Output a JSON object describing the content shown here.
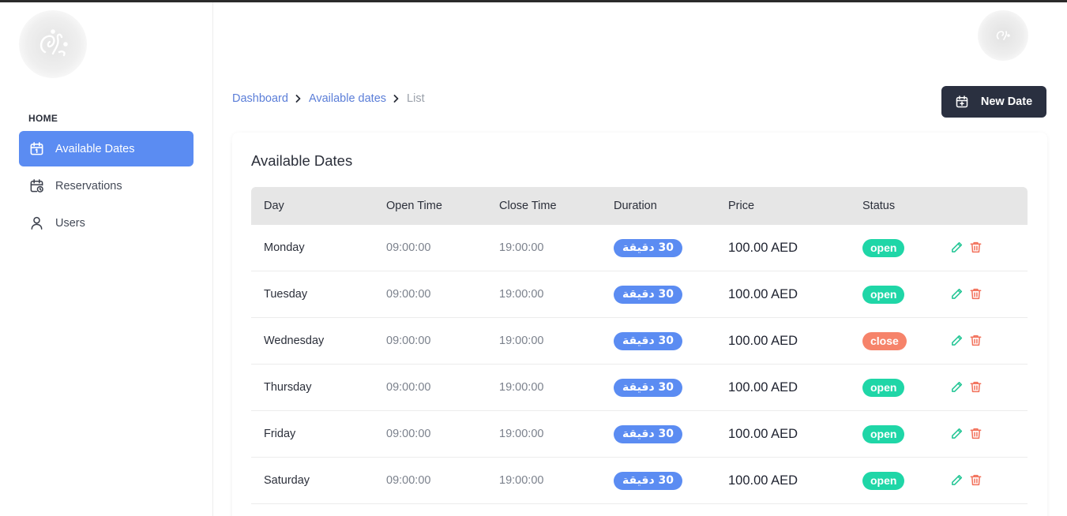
{
  "sidebar": {
    "section_label": "HOME",
    "items": [
      {
        "label": "Available Dates",
        "icon": "calendar-icon",
        "active": true
      },
      {
        "label": "Reservations",
        "icon": "calendar-clock-icon",
        "active": false
      },
      {
        "label": "Users",
        "icon": "user-icon",
        "active": false
      }
    ]
  },
  "breadcrumb": {
    "items": [
      "Dashboard",
      "Available dates",
      "List"
    ]
  },
  "toolbar": {
    "new_date_label": "New Date"
  },
  "card": {
    "title": "Available Dates"
  },
  "table": {
    "columns": [
      "Day",
      "Open Time",
      "Close Time",
      "Duration",
      "Price",
      "Status"
    ],
    "rows": [
      {
        "day": "Monday",
        "open": "09:00:00",
        "close": "19:00:00",
        "duration": "30 دقيقة",
        "price": "100.00 AED",
        "status": "open"
      },
      {
        "day": "Tuesday",
        "open": "09:00:00",
        "close": "19:00:00",
        "duration": "30 دقيقة",
        "price": "100.00 AED",
        "status": "open"
      },
      {
        "day": "Wednesday",
        "open": "09:00:00",
        "close": "19:00:00",
        "duration": "30 دقيقة",
        "price": "100.00 AED",
        "status": "close"
      },
      {
        "day": "Thursday",
        "open": "09:00:00",
        "close": "19:00:00",
        "duration": "30 دقيقة",
        "price": "100.00 AED",
        "status": "open"
      },
      {
        "day": "Friday",
        "open": "09:00:00",
        "close": "19:00:00",
        "duration": "30 دقيقة",
        "price": "100.00 AED",
        "status": "open"
      },
      {
        "day": "Saturday",
        "open": "09:00:00",
        "close": "19:00:00",
        "duration": "30 دقيقة",
        "price": "100.00 AED",
        "status": "open"
      }
    ]
  },
  "colors": {
    "accent": "#5b8cf2",
    "dark_button": "#2a3040",
    "status_open": "#1fd6a7",
    "status_close": "#f6836a",
    "edit_icon": "#1fc593",
    "delete_icon": "#f2705a",
    "link": "#5b7ed8"
  },
  "icons": {
    "logo": "brand-logo",
    "avatar": "user-avatar",
    "edit": "pencil-icon",
    "delete": "trash-icon",
    "new_date": "calendar-plus-icon",
    "breadcrumb_separator": "chevron-right-icon"
  }
}
